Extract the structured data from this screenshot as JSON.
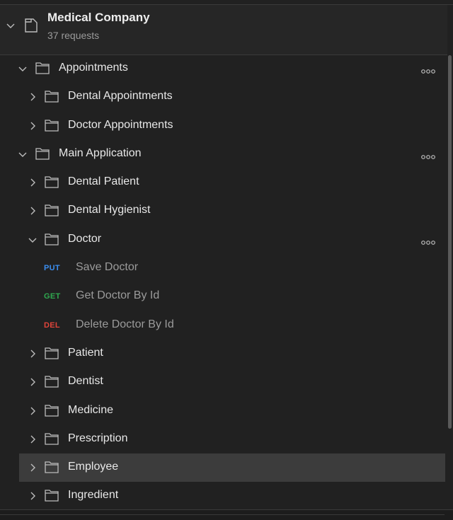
{
  "collection": {
    "name": "Medical Company",
    "count": "37 requests"
  },
  "colors": {
    "background": "#212121",
    "selected_row": "#3c3c3c",
    "put": "#3b8ef0",
    "get": "#2fa84f",
    "del": "#e0443a"
  },
  "tree": {
    "appointments": {
      "label": "Appointments"
    },
    "dental_appointments": {
      "label": "Dental Appointments"
    },
    "doctor_appointments": {
      "label": "Doctor Appointments"
    },
    "main_application": {
      "label": "Main Application"
    },
    "dental_patient": {
      "label": "Dental Patient"
    },
    "dental_hygienist": {
      "label": "Dental Hygienist"
    },
    "doctor": {
      "label": "Doctor"
    },
    "save_doctor": {
      "method": "PUT",
      "label": "Save Doctor"
    },
    "get_doctor": {
      "method": "GET",
      "label": "Get Doctor By Id"
    },
    "delete_doctor": {
      "method": "DEL",
      "label": "Delete Doctor By Id"
    },
    "patient": {
      "label": "Patient"
    },
    "dentist": {
      "label": "Dentist"
    },
    "medicine": {
      "label": "Medicine"
    },
    "prescription": {
      "label": "Prescription"
    },
    "employee": {
      "label": "Employee",
      "selected": true
    },
    "ingredient": {
      "label": "Ingredient"
    }
  },
  "icons": {
    "expanded": "chevron-down-icon",
    "collapsed": "chevron-right-icon",
    "folder": "folder-icon",
    "collection": "collection-icon",
    "more": "more-options-icon"
  }
}
